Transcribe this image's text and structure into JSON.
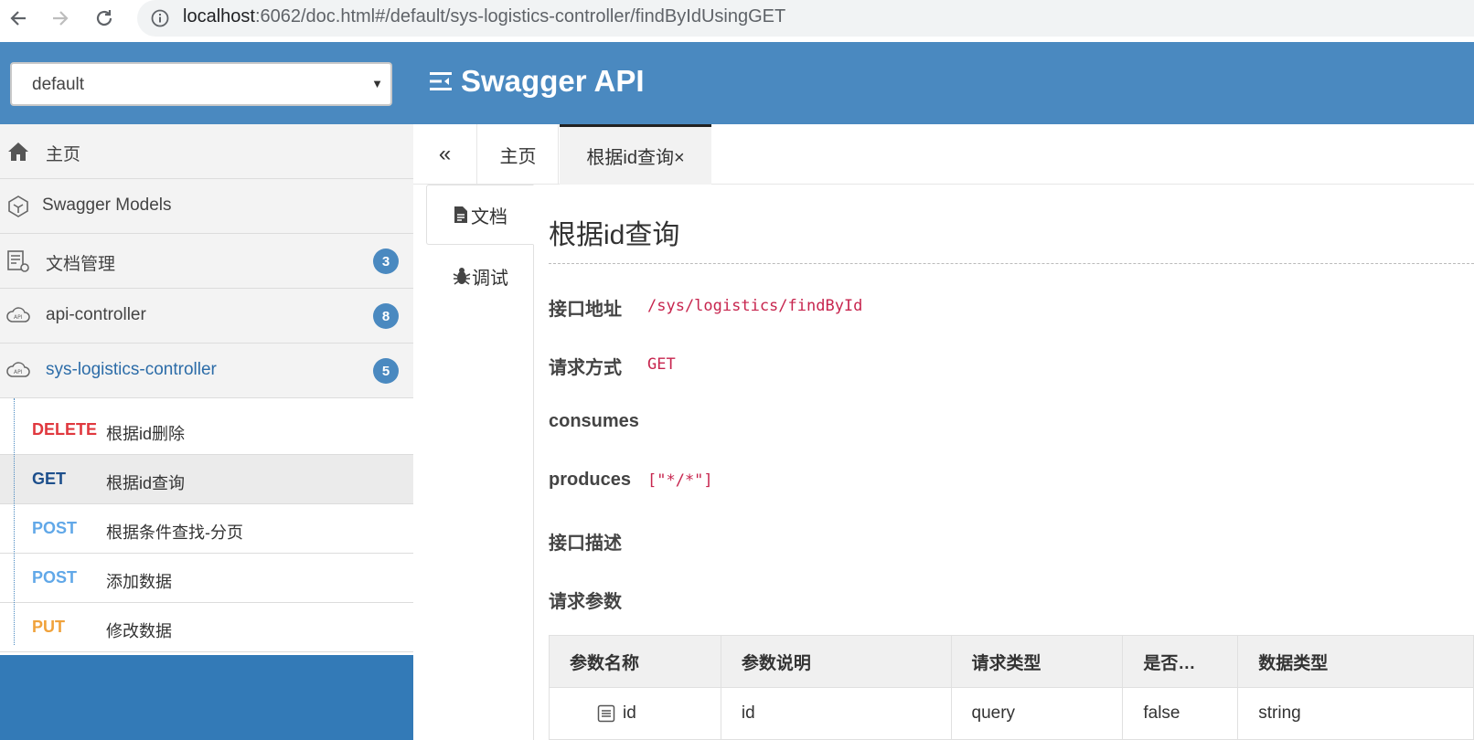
{
  "browser": {
    "url_host": "localhost",
    "url_rest": ":6062/doc.html#/default/sys-logistics-controller/findByIdUsingGET"
  },
  "header": {
    "group_selected": "default",
    "brand_title": "Swagger API"
  },
  "sidebar": {
    "items": [
      {
        "label": "主页",
        "icon": "home-icon"
      },
      {
        "label": "Swagger Models",
        "icon": "models-icon"
      },
      {
        "label": "文档管理",
        "icon": "doc-settings-icon",
        "badge": "3"
      },
      {
        "label": "api-controller",
        "icon": "api-cloud-icon",
        "badge": "8"
      },
      {
        "label": "sys-logistics-controller",
        "icon": "api-cloud-icon",
        "badge": "5"
      }
    ],
    "endpoints": [
      {
        "method": "DELETE",
        "desc": "根据id删除",
        "color": "#e0383e"
      },
      {
        "method": "GET",
        "desc": "根据id查询",
        "color": "#1d4f8c"
      },
      {
        "method": "POST",
        "desc": "根据条件查找-分页",
        "color": "#61a8e8"
      },
      {
        "method": "POST",
        "desc": "添加数据",
        "color": "#61a8e8"
      },
      {
        "method": "PUT",
        "desc": "修改数据",
        "color": "#f0a23b"
      }
    ]
  },
  "tabs": {
    "home": "主页",
    "active": "根据id查询×"
  },
  "vtabs": {
    "doc": "文档",
    "debug": "调试"
  },
  "doc": {
    "title": "根据id查询",
    "fields": [
      {
        "label": "接口地址",
        "value": "/sys/logistics/findById"
      },
      {
        "label": "请求方式",
        "value": "GET"
      },
      {
        "label": "consumes",
        "value": ""
      },
      {
        "label": "produces",
        "value": "[\"*/*\"]"
      },
      {
        "label": "接口描述",
        "value": ""
      },
      {
        "label": "请求参数",
        "value": ""
      }
    ],
    "param_table": {
      "headers": [
        "参数名称",
        "参数说明",
        "请求类型",
        "是否…",
        "数据类型"
      ],
      "rows": [
        {
          "name": "id",
          "desc": "id",
          "in": "query",
          "required": "false",
          "type": "string"
        }
      ]
    }
  }
}
